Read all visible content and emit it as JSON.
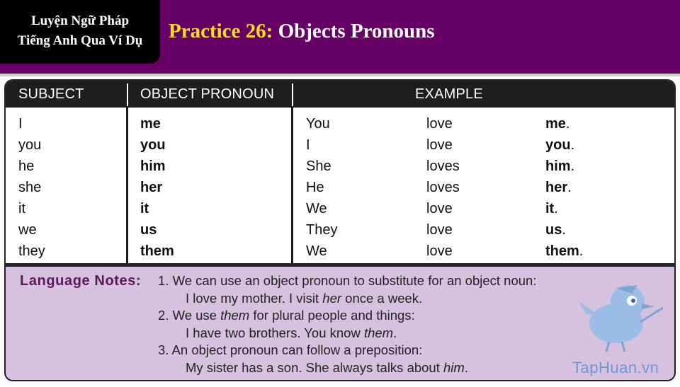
{
  "header": {
    "badge_line1": "Luyện Ngữ Pháp",
    "badge_line2": "Tiếng Anh Qua Ví Dụ",
    "title_number": "Practice 26:",
    "title_text": "Objects Pronouns"
  },
  "table": {
    "headers": [
      "SUBJECT",
      "OBJECT PRONOUN",
      "EXAMPLE"
    ],
    "rows": [
      {
        "subject": "I",
        "object": "me",
        "ex_subject": "You",
        "ex_verb": "love",
        "ex_object": "me",
        "punct": "."
      },
      {
        "subject": "you",
        "object": "you",
        "ex_subject": "I",
        "ex_verb": "love",
        "ex_object": "you",
        "punct": "."
      },
      {
        "subject": "he",
        "object": "him",
        "ex_subject": "She",
        "ex_verb": "loves",
        "ex_object": "him",
        "punct": "."
      },
      {
        "subject": "she",
        "object": "her",
        "ex_subject": "He",
        "ex_verb": "loves",
        "ex_object": "her",
        "punct": "."
      },
      {
        "subject": "it",
        "object": "it",
        "ex_subject": "We",
        "ex_verb": "love",
        "ex_object": "it",
        "punct": "."
      },
      {
        "subject": "we",
        "object": "us",
        "ex_subject": "They",
        "ex_verb": "love",
        "ex_object": "us",
        "punct": "."
      },
      {
        "subject": "they",
        "object": "them",
        "ex_subject": "We",
        "ex_verb": "love",
        "ex_object": "them",
        "punct": "."
      }
    ]
  },
  "notes": {
    "label": "Language Notes:",
    "note1": "1. We can use an object pronoun to substitute for an object noun:",
    "example1_a": "I love my mother. I visit ",
    "example1_em": "her",
    "example1_b": " once a week.",
    "note2_a": "2. We use ",
    "note2_em": "them",
    "note2_b": " for plural people and things:",
    "example2_a": "I have two brothers. You know ",
    "example2_em": "them",
    "example2_b": ".",
    "note3": "3. An object pronoun can follow a preposition:",
    "example3_a": "My sister has a son. She always talks about ",
    "example3_em": "him",
    "example3_b": ".",
    "watermark": "TapHuan.vn"
  },
  "colors": {
    "banner": "#660066",
    "title_number": "#ffe01b",
    "notes_bg": "#d6c1de",
    "notes_label": "#5a1a5a",
    "watermark": "#6d9ad0"
  },
  "icons": [
    "bird-mascot-icon"
  ]
}
